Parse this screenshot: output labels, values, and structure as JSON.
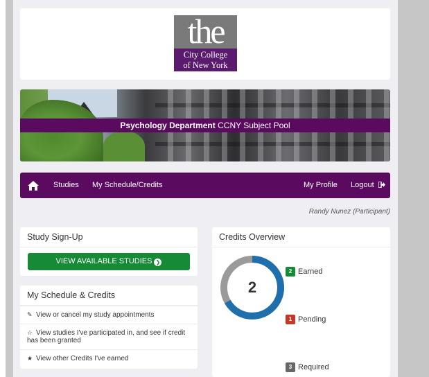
{
  "logo": {
    "word": "the",
    "line1": "City College",
    "line2": "of New York"
  },
  "banner": {
    "dept": "Psychology Department",
    "pool": "CCNY Subject Pool"
  },
  "nav": {
    "studies": "Studies",
    "schedule": "My Schedule/Credits",
    "profile": "My Profile",
    "logout": "Logout"
  },
  "user": {
    "name": "Randy Nunez (Participant)"
  },
  "signup": {
    "title": "Study Sign-Up",
    "button": "VIEW AVAILABLE STUDIES"
  },
  "schedule": {
    "title": "My Schedule & Credits",
    "items": [
      "View or cancel my study appointments",
      "View studies I've participated in, and see if credit has been granted",
      "View other Credits I've earned"
    ]
  },
  "credits": {
    "title": "Credits Overview",
    "total": "2",
    "earned": {
      "count": "2",
      "label": "Earned"
    },
    "pending": {
      "count": "1",
      "label": "Pending"
    },
    "required": {
      "count": "3",
      "label": "Required"
    },
    "donut_fraction_earned": 0.667
  },
  "colors": {
    "purple": "#5a0a5f",
    "green": "#178a36",
    "earned": "#178a36",
    "pending": "#c0392b",
    "required": "#666666",
    "donut_blue": "#1f6fad",
    "donut_gray": "#9a9a9a"
  },
  "icons": {
    "home": "home-icon",
    "logout": "sign-out-icon",
    "arrow": "arrow-circle-right-icon",
    "edit": "edit-icon",
    "star_half": "star-half-icon",
    "star": "star-icon"
  }
}
